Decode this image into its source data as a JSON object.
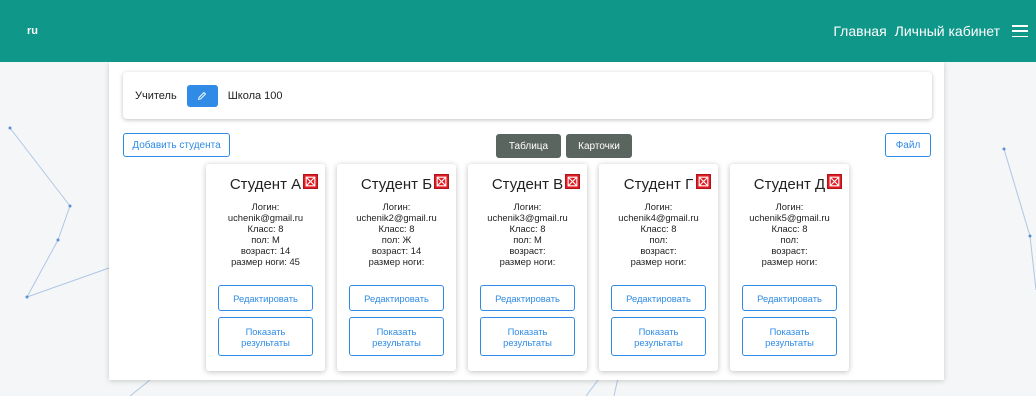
{
  "navbar": {
    "brand": "ru",
    "links": [
      "Главная",
      "Личный кабинет"
    ],
    "color": "#0f978a"
  },
  "teacher": {
    "label": "Учитель",
    "school": "Школа 100"
  },
  "toolbar": {
    "add_student": "Добавить студента",
    "view_table": "Таблица",
    "view_cards": "Карточки",
    "file": "Файл"
  },
  "students": [
    {
      "name": "Студент А",
      "login_label": "Логин:",
      "login": "uchenik@gmail.ru",
      "class": "Класс: 8",
      "sex": "пол: М",
      "age": "возраст: 14",
      "foot": "размер ноги: 45",
      "edit": "Редактировать",
      "results": "Показать результаты"
    },
    {
      "name": "Студент Б",
      "login_label": "Логин:",
      "login": "uchenik2@gmail.ru",
      "class": "Класс: 8",
      "sex": "пол: Ж",
      "age": "возраст: 14",
      "foot": "размер ноги:",
      "edit": "Редактировать",
      "results": "Показать результаты"
    },
    {
      "name": "Студент В",
      "login_label": "Логин:",
      "login": "uchenik3@gmail.ru",
      "class": "Класс: 8",
      "sex": "пол: М",
      "age": "возраст:",
      "foot": "размер ноги:",
      "edit": "Редактировать",
      "results": "Показать результаты"
    },
    {
      "name": "Студент Г",
      "login_label": "Логин:",
      "login": "uchenik4@gmail.ru",
      "class": "Класс: 8",
      "sex": "пол:",
      "age": "возраст:",
      "foot": "размер ноги:",
      "edit": "Редактировать",
      "results": "Показать результаты"
    },
    {
      "name": "Студент Д",
      "login_label": "Логин:",
      "login": "uchenik5@gmail.ru",
      "class": "Класс: 8",
      "sex": "пол:",
      "age": "возраст:",
      "foot": "размер ноги:",
      "edit": "Редактировать",
      "results": "Показать результаты"
    }
  ]
}
